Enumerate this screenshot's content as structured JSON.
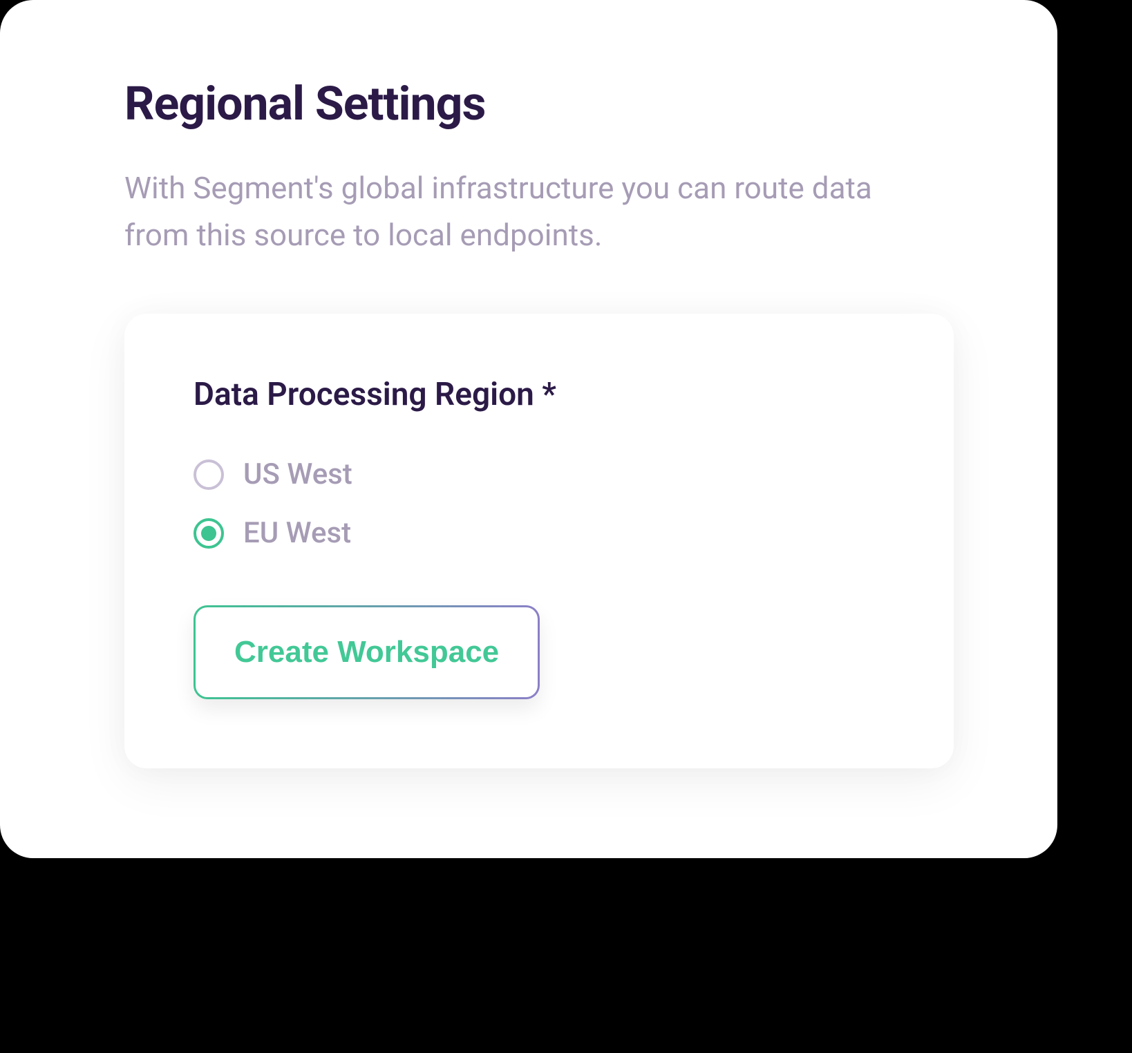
{
  "header": {
    "title": "Regional Settings",
    "description": "With Segment's global infrastructure you can route data from this source to local endpoints."
  },
  "region_section": {
    "label": "Data Processing Region *",
    "options": [
      {
        "label": "US West",
        "selected": false
      },
      {
        "label": "EU West",
        "selected": true
      }
    ]
  },
  "actions": {
    "create_workspace_label": "Create Workspace"
  },
  "colors": {
    "heading": "#2b1a47",
    "muted_text": "#a69cb5",
    "accent_green": "#3dc491",
    "accent_purple": "#8b7fc7"
  }
}
